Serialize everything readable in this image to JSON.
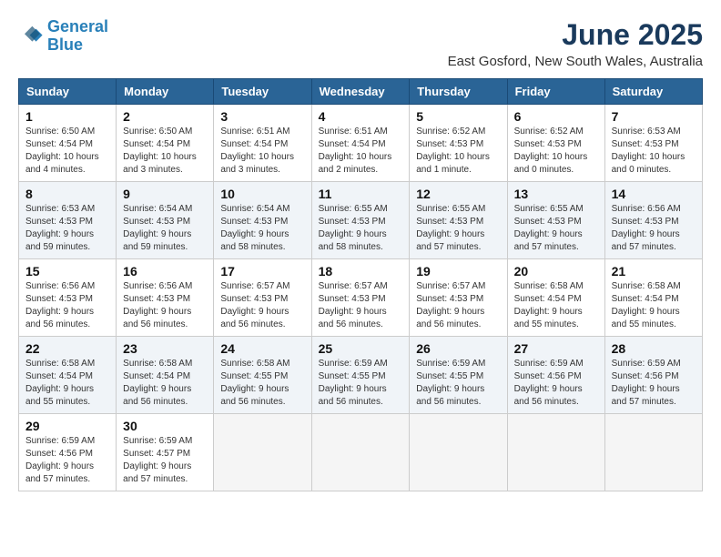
{
  "header": {
    "logo_line1": "General",
    "logo_line2": "Blue",
    "month": "June 2025",
    "location": "East Gosford, New South Wales, Australia"
  },
  "weekdays": [
    "Sunday",
    "Monday",
    "Tuesday",
    "Wednesday",
    "Thursday",
    "Friday",
    "Saturday"
  ],
  "weeks": [
    [
      {
        "day": "1",
        "sunrise": "6:50 AM",
        "sunset": "4:54 PM",
        "daylight": "10 hours and 4 minutes."
      },
      {
        "day": "2",
        "sunrise": "6:50 AM",
        "sunset": "4:54 PM",
        "daylight": "10 hours and 3 minutes."
      },
      {
        "day": "3",
        "sunrise": "6:51 AM",
        "sunset": "4:54 PM",
        "daylight": "10 hours and 3 minutes."
      },
      {
        "day": "4",
        "sunrise": "6:51 AM",
        "sunset": "4:54 PM",
        "daylight": "10 hours and 2 minutes."
      },
      {
        "day": "5",
        "sunrise": "6:52 AM",
        "sunset": "4:53 PM",
        "daylight": "10 hours and 1 minute."
      },
      {
        "day": "6",
        "sunrise": "6:52 AM",
        "sunset": "4:53 PM",
        "daylight": "10 hours and 0 minutes."
      },
      {
        "day": "7",
        "sunrise": "6:53 AM",
        "sunset": "4:53 PM",
        "daylight": "10 hours and 0 minutes."
      }
    ],
    [
      {
        "day": "8",
        "sunrise": "6:53 AM",
        "sunset": "4:53 PM",
        "daylight": "9 hours and 59 minutes."
      },
      {
        "day": "9",
        "sunrise": "6:54 AM",
        "sunset": "4:53 PM",
        "daylight": "9 hours and 59 minutes."
      },
      {
        "day": "10",
        "sunrise": "6:54 AM",
        "sunset": "4:53 PM",
        "daylight": "9 hours and 58 minutes."
      },
      {
        "day": "11",
        "sunrise": "6:55 AM",
        "sunset": "4:53 PM",
        "daylight": "9 hours and 58 minutes."
      },
      {
        "day": "12",
        "sunrise": "6:55 AM",
        "sunset": "4:53 PM",
        "daylight": "9 hours and 57 minutes."
      },
      {
        "day": "13",
        "sunrise": "6:55 AM",
        "sunset": "4:53 PM",
        "daylight": "9 hours and 57 minutes."
      },
      {
        "day": "14",
        "sunrise": "6:56 AM",
        "sunset": "4:53 PM",
        "daylight": "9 hours and 57 minutes."
      }
    ],
    [
      {
        "day": "15",
        "sunrise": "6:56 AM",
        "sunset": "4:53 PM",
        "daylight": "9 hours and 56 minutes."
      },
      {
        "day": "16",
        "sunrise": "6:56 AM",
        "sunset": "4:53 PM",
        "daylight": "9 hours and 56 minutes."
      },
      {
        "day": "17",
        "sunrise": "6:57 AM",
        "sunset": "4:53 PM",
        "daylight": "9 hours and 56 minutes."
      },
      {
        "day": "18",
        "sunrise": "6:57 AM",
        "sunset": "4:53 PM",
        "daylight": "9 hours and 56 minutes."
      },
      {
        "day": "19",
        "sunrise": "6:57 AM",
        "sunset": "4:53 PM",
        "daylight": "9 hours and 56 minutes."
      },
      {
        "day": "20",
        "sunrise": "6:58 AM",
        "sunset": "4:54 PM",
        "daylight": "9 hours and 55 minutes."
      },
      {
        "day": "21",
        "sunrise": "6:58 AM",
        "sunset": "4:54 PM",
        "daylight": "9 hours and 55 minutes."
      }
    ],
    [
      {
        "day": "22",
        "sunrise": "6:58 AM",
        "sunset": "4:54 PM",
        "daylight": "9 hours and 55 minutes."
      },
      {
        "day": "23",
        "sunrise": "6:58 AM",
        "sunset": "4:54 PM",
        "daylight": "9 hours and 56 minutes."
      },
      {
        "day": "24",
        "sunrise": "6:58 AM",
        "sunset": "4:55 PM",
        "daylight": "9 hours and 56 minutes."
      },
      {
        "day": "25",
        "sunrise": "6:59 AM",
        "sunset": "4:55 PM",
        "daylight": "9 hours and 56 minutes."
      },
      {
        "day": "26",
        "sunrise": "6:59 AM",
        "sunset": "4:55 PM",
        "daylight": "9 hours and 56 minutes."
      },
      {
        "day": "27",
        "sunrise": "6:59 AM",
        "sunset": "4:56 PM",
        "daylight": "9 hours and 56 minutes."
      },
      {
        "day": "28",
        "sunrise": "6:59 AM",
        "sunset": "4:56 PM",
        "daylight": "9 hours and 57 minutes."
      }
    ],
    [
      {
        "day": "29",
        "sunrise": "6:59 AM",
        "sunset": "4:56 PM",
        "daylight": "9 hours and 57 minutes."
      },
      {
        "day": "30",
        "sunrise": "6:59 AM",
        "sunset": "4:57 PM",
        "daylight": "9 hours and 57 minutes."
      },
      null,
      null,
      null,
      null,
      null
    ]
  ]
}
